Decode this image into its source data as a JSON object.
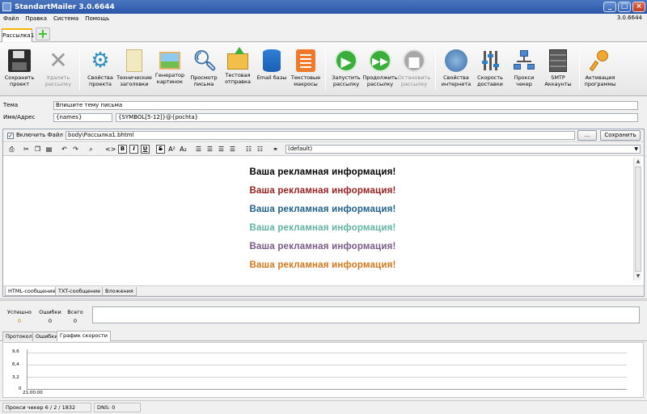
{
  "window": {
    "title": "StandartMailer 3.0.6644"
  },
  "menu": {
    "items": [
      "Файл",
      "Правка",
      "Система",
      "Помощь"
    ],
    "version": "3.0.6644"
  },
  "doc_tabs": {
    "active": "Рассылка1",
    "add_symbol": "+"
  },
  "toolbar": {
    "save_project": "Сохранить проект",
    "delete_mailing": "Удалить рассылку",
    "project_props": "Свойства проекта",
    "tech_headers": "Технические заголовки",
    "image_gen": "Генератор картинок",
    "preview": "Просмотр письма",
    "test_send": "Тестовая отправка",
    "email_bases": "Email базы",
    "text_macros": "Текстовые макросы",
    "start": "Запустить рассылку",
    "continue": "Продолжить рассылку",
    "stop": "Остановить рассылку",
    "internet_props": "Свойства интернета",
    "delivery_speed": "Скорость доставки",
    "proxy_checker": "Прокси чекер",
    "smtp_accounts": "SMTP Аккаунты",
    "activation": "Активация программы"
  },
  "fields": {
    "subject_label": "Тема",
    "subject_value": "Впишите тему письма",
    "name_address_label": "Имя/Адрес",
    "name_value": "{names}",
    "address_value": "{SYMBOL[5-12]}@{pochta}"
  },
  "editor": {
    "include_file_label": "Включить Файл :",
    "file_path": "body\\Рассылка1.bhtml",
    "browse_label": "...",
    "save_label": "Сохранить",
    "font_select": "(default)",
    "ad_text": "Ваша рекламная информация!",
    "ad_colors": [
      "#000000",
      "#9b1c1c",
      "#1f5f8b",
      "#5fb3a0",
      "#7a5a8c",
      "#d4771a"
    ],
    "tabs": [
      "HTML-сообщение",
      "TXT-сообщение",
      "Вложения"
    ]
  },
  "stats": {
    "success_label": "Успешно",
    "success_value": "0",
    "errors_label": "Ошибки",
    "errors_value": "0",
    "total_label": "Всего",
    "total_value": "0"
  },
  "bottom_tabs": [
    "Протокол",
    "Ошибки",
    "График скорости"
  ],
  "chart_data": {
    "type": "line",
    "yticks": [
      "9,6",
      "6,4",
      "3,2",
      "0"
    ],
    "xticks": [
      "21:00:00"
    ],
    "ylim": [
      0,
      9.6
    ],
    "series": []
  },
  "statusbar": {
    "proxy": "Прокси чекер   6 / 2 / 1832",
    "dns": "DNS:   0"
  }
}
